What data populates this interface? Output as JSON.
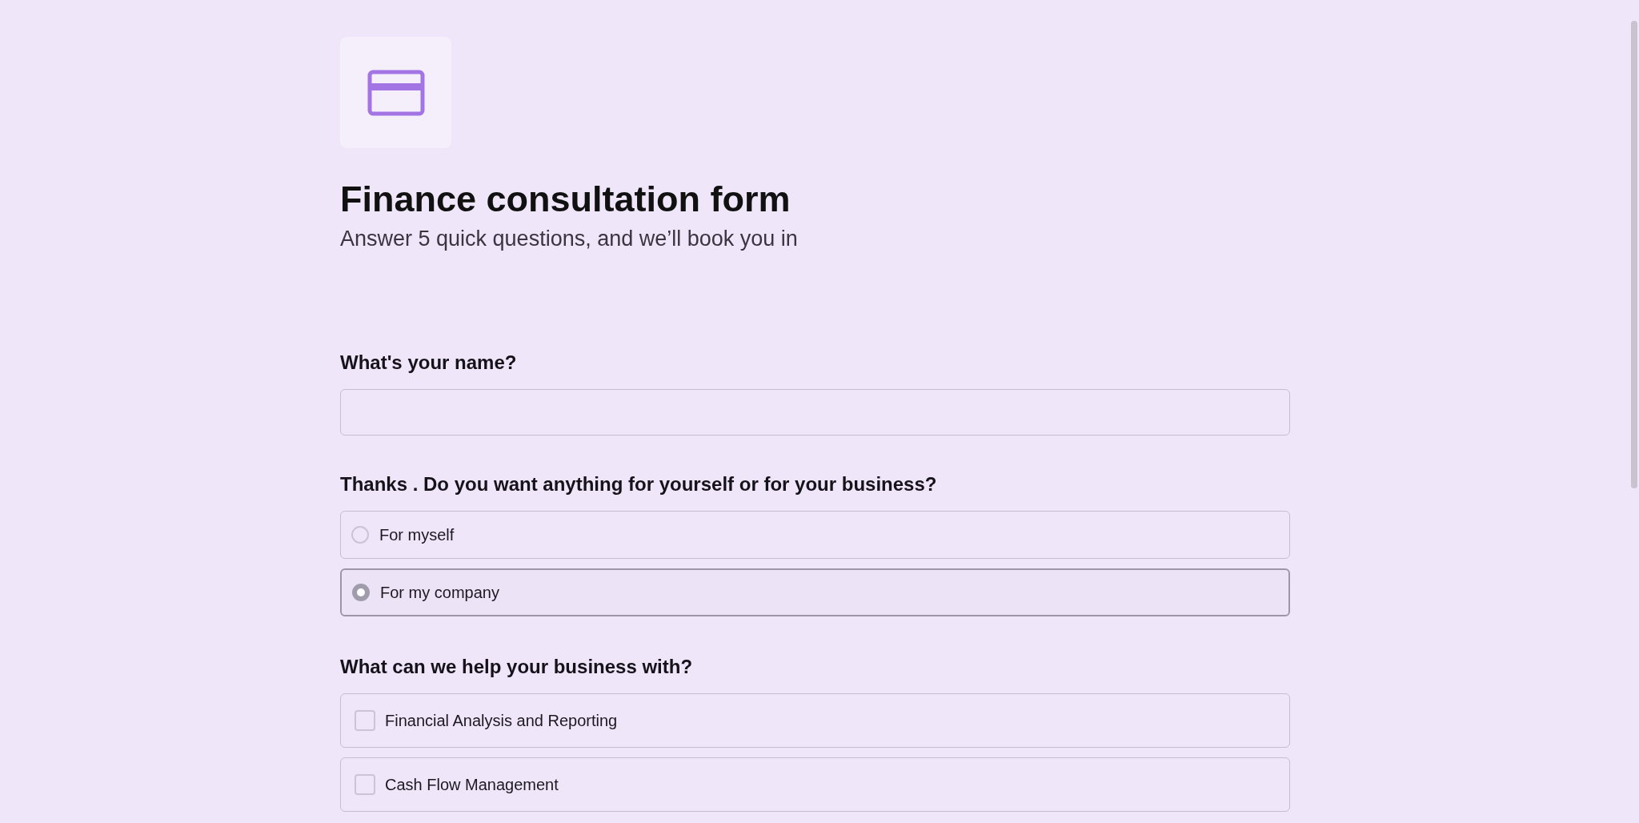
{
  "header": {
    "title": "Finance consultation form",
    "subtitle": "Answer 5 quick questions, and we’ll book you in"
  },
  "questions": [
    {
      "kind": "text",
      "label": "What's your name?"
    },
    {
      "kind": "radio",
      "label": "Thanks . Do you want anything for yourself or for your business?",
      "options": [
        {
          "label": "For myself",
          "selected": false
        },
        {
          "label": "For my company",
          "selected": true
        }
      ]
    },
    {
      "kind": "checkbox",
      "label": "What can we help your business with?",
      "options": [
        {
          "label": "Financial Analysis and Reporting",
          "checked": false
        },
        {
          "label": "Cash Flow Management",
          "checked": false
        }
      ]
    }
  ]
}
